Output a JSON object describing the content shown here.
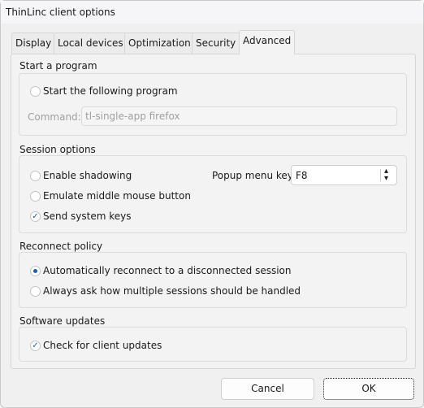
{
  "window": {
    "title": "ThinLinc client options"
  },
  "tabs": [
    {
      "label": "Display"
    },
    {
      "label": "Local devices"
    },
    {
      "label": "Optimization"
    },
    {
      "label": "Security"
    },
    {
      "label": "Advanced",
      "active": true
    }
  ],
  "start_program": {
    "title": "Start a program",
    "option": "Start the following program",
    "checked": false,
    "command_label": "Command:",
    "command_value": "tl-single-app firefox"
  },
  "session": {
    "title": "Session options",
    "shadowing": {
      "label": "Enable shadowing",
      "checked": false
    },
    "middle": {
      "label": "Emulate middle mouse button",
      "checked": false
    },
    "syskeys": {
      "label": "Send system keys",
      "checked": true
    },
    "popup_label": "Popup menu key",
    "popup_value": "F8"
  },
  "reconnect": {
    "title": "Reconnect policy",
    "auto": {
      "label": "Automatically reconnect to a disconnected session",
      "selected": true
    },
    "ask": {
      "label": "Always ask how multiple sessions should be handled",
      "selected": false
    }
  },
  "updates": {
    "title": "Software updates",
    "check": {
      "label": "Check for client updates",
      "checked": true
    }
  },
  "buttons": {
    "cancel": "Cancel",
    "ok": "OK"
  },
  "colors": {
    "accent": "#1a5fb4"
  }
}
